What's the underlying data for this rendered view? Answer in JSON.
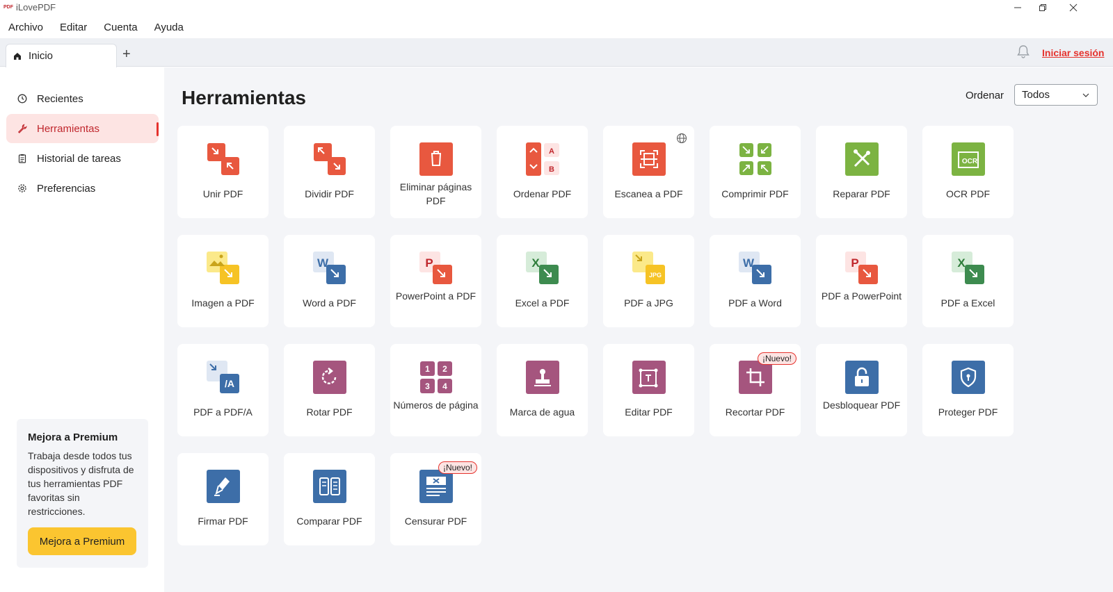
{
  "window": {
    "title": "iLovePDF",
    "logo_text": "PDF"
  },
  "menu": [
    "Archivo",
    "Editar",
    "Cuenta",
    "Ayuda"
  ],
  "tab": {
    "label": "Inicio",
    "add_label": "+"
  },
  "header": {
    "login": "Iniciar sesión"
  },
  "sidebar": {
    "items": [
      {
        "label": "Recientes",
        "icon": "clock-icon"
      },
      {
        "label": "Herramientas",
        "icon": "wrench-icon"
      },
      {
        "label": "Historial de tareas",
        "icon": "clipboard-icon"
      },
      {
        "label": "Preferencias",
        "icon": "gear-icon"
      }
    ],
    "premium": {
      "title": "Mejora a Premium",
      "text": "Trabaja desde todos tus dispositivos y disfruta de tus herramientas PDF favoritas sin restricciones.",
      "button": "Mejora a Premium"
    }
  },
  "main": {
    "title": "Herramientas",
    "sort_label": "Ordenar",
    "sort_value": "Todos",
    "new_badge": "¡Nuevo!",
    "tools": [
      {
        "label": "Unir PDF",
        "icon": "merge-icon",
        "color": "#e8583f"
      },
      {
        "label": "Dividir PDF",
        "icon": "split-icon",
        "color": "#e8583f"
      },
      {
        "label": "Eliminar páginas PDF",
        "icon": "trash-icon",
        "color": "#e8583f"
      },
      {
        "label": "Ordenar PDF",
        "icon": "organize-icon",
        "color": "#e8583f"
      },
      {
        "label": "Escanea a PDF",
        "icon": "scan-icon",
        "color": "#e8583f"
      },
      {
        "label": "Comprimir PDF",
        "icon": "compress-icon",
        "color": "#7cb342"
      },
      {
        "label": "Reparar PDF",
        "icon": "repair-icon",
        "color": "#7cb342"
      },
      {
        "label": "OCR PDF",
        "icon": "ocr-icon",
        "color": "#7cb342"
      },
      {
        "label": "Imagen a PDF",
        "icon": "image-icon",
        "color": "#f6c325"
      },
      {
        "label": "Word a PDF",
        "icon": "word-icon",
        "color": "#3d6ea8"
      },
      {
        "label": "PowerPoint a PDF",
        "icon": "powerpoint-icon",
        "color": "#e8583f"
      },
      {
        "label": "Excel a PDF",
        "icon": "excel-icon",
        "color": "#3d8b4f"
      },
      {
        "label": "PDF a JPG",
        "icon": "jpg-icon",
        "color": "#f6c325"
      },
      {
        "label": "PDF a Word",
        "icon": "word-icon",
        "color": "#3d6ea8"
      },
      {
        "label": "PDF a PowerPoint",
        "icon": "powerpoint-icon",
        "color": "#e8583f"
      },
      {
        "label": "PDF a Excel",
        "icon": "excel-icon",
        "color": "#3d8b4f"
      },
      {
        "label": "PDF a PDF/A",
        "icon": "pdfa-icon",
        "color": "#3d6ea8"
      },
      {
        "label": "Rotar PDF",
        "icon": "rotate-icon",
        "color": "#a5557e"
      },
      {
        "label": "Números de página",
        "icon": "page-numbers-icon",
        "color": "#a5557e"
      },
      {
        "label": "Marca de agua",
        "icon": "stamp-icon",
        "color": "#a5557e"
      },
      {
        "label": "Editar PDF",
        "icon": "edit-icon",
        "color": "#a5557e"
      },
      {
        "label": "Recortar PDF",
        "icon": "crop-icon",
        "color": "#a5557e"
      },
      {
        "label": "Desbloquear PDF",
        "icon": "unlock-icon",
        "color": "#3d6ea8"
      },
      {
        "label": "Proteger PDF",
        "icon": "shield-icon",
        "color": "#3d6ea8"
      },
      {
        "label": "Firmar PDF",
        "icon": "pen-icon",
        "color": "#3d6ea8"
      },
      {
        "label": "Comparar PDF",
        "icon": "compare-icon",
        "color": "#3d6ea8"
      },
      {
        "label": "Censurar PDF",
        "icon": "redact-icon",
        "color": "#3d6ea8"
      }
    ]
  }
}
